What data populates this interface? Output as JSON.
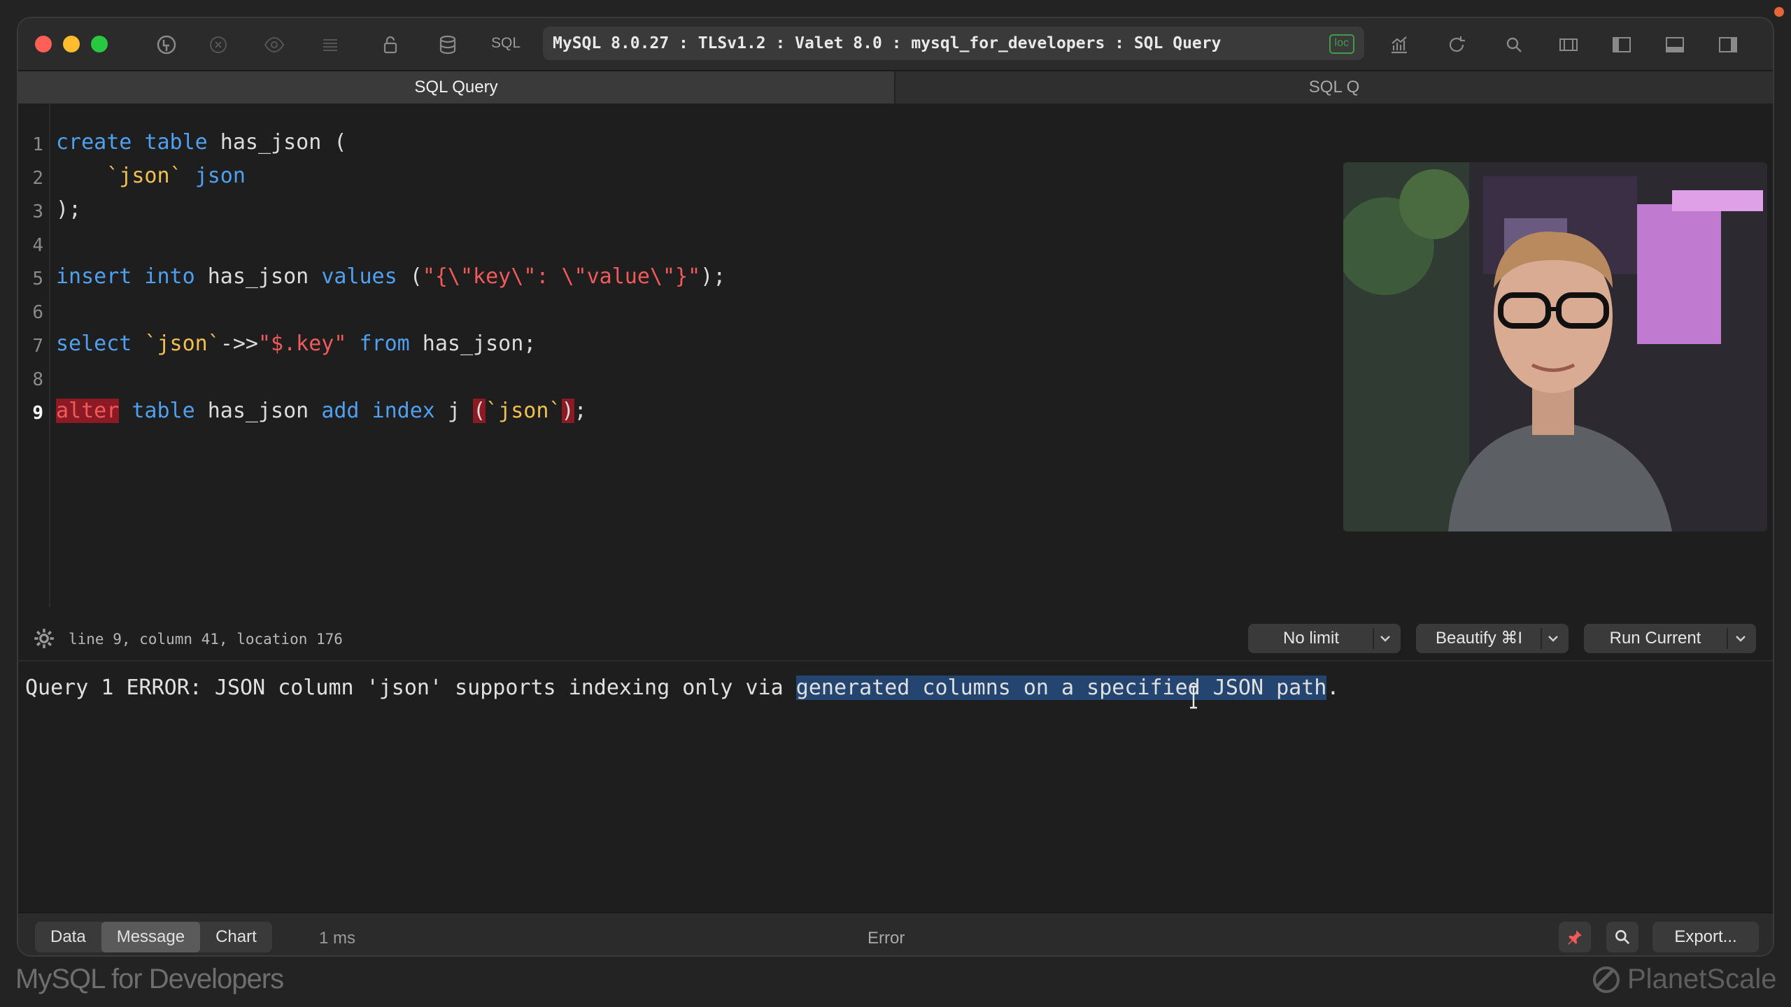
{
  "titlebar": {
    "sql_label": "SQL",
    "connection": "MySQL 8.0.27 : TLSv1.2 : Valet 8.0 : mysql_for_developers : SQL Query",
    "loc_badge": "loc"
  },
  "tabs": [
    {
      "label": "SQL Query",
      "active": true
    },
    {
      "label": "SQL Q",
      "active": false
    }
  ],
  "editor": {
    "line_numbers": [
      "1",
      "2",
      "3",
      "4",
      "5",
      "6",
      "7",
      "8",
      "9"
    ],
    "current_line": 9
  },
  "status": {
    "position": "line 9, column 41, location 176",
    "limit_label": "No limit",
    "beautify_label": "Beautify ⌘I",
    "run_label": "Run Current"
  },
  "output": {
    "error_prefix": "Query 1 ERROR: JSON column 'json' supports indexing only via ",
    "error_selected": "generated columns on a specified JSON path",
    "error_suffix": "."
  },
  "bottombar": {
    "tab_data": "Data",
    "tab_message": "Message",
    "tab_chart": "Chart",
    "duration": "1 ms",
    "status": "Error",
    "export_label": "Export..."
  },
  "branding": {
    "left": "MySQL for Developers",
    "right": "PlanetScale"
  },
  "colors": {
    "accent_red": "#f05a5a",
    "keyword_blue": "#4fa0f0",
    "string_yellow": "#f0c050",
    "selection": "#23456f"
  }
}
